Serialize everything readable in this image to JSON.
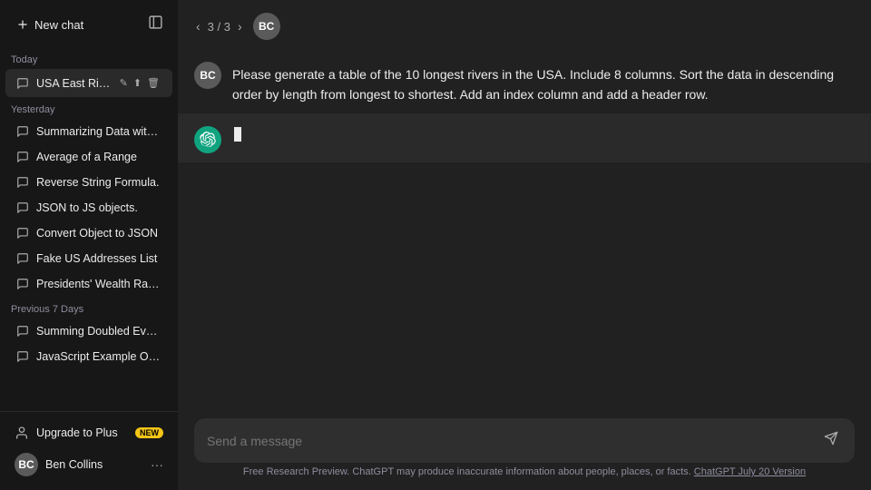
{
  "sidebar": {
    "new_chat_label": "New chat",
    "toggle_icon": "sidebar-icon",
    "today_label": "Today",
    "yesterday_label": "Yesterday",
    "previous7_label": "Previous 7 Days",
    "active_chat": "USA East Rivers Tab",
    "today_chats": [
      {
        "id": "usa-east-rivers",
        "label": "USA East Rivers Tab",
        "active": true
      }
    ],
    "yesterday_chats": [
      {
        "id": "summarizing-data",
        "label": "Summarizing Data with Formu..."
      },
      {
        "id": "average-range",
        "label": "Average of a Range"
      },
      {
        "id": "reverse-string",
        "label": "Reverse String Formula."
      },
      {
        "id": "json-js",
        "label": "JSON to JS objects."
      },
      {
        "id": "convert-object",
        "label": "Convert Object to JSON"
      },
      {
        "id": "fake-addresses",
        "label": "Fake US Addresses List"
      },
      {
        "id": "presidents-wealth",
        "label": "Presidents' Wealth Ranking"
      }
    ],
    "previous_chats": [
      {
        "id": "summing-doubled",
        "label": "Summing Doubled Even Num..."
      },
      {
        "id": "js-example",
        "label": "JavaScript Example Object."
      }
    ],
    "upgrade_label": "Upgrade to Plus",
    "new_badge": "NEW",
    "user_name": "Ben Collins",
    "user_initials": "BC"
  },
  "chat": {
    "nav_label": "3 / 3",
    "user_message": "Please generate a table of the 10 longest rivers in the USA. Include 8 columns. Sort the data in descending order by length from longest to shortest. Add an index column and add a header row.",
    "ai_responding": true
  },
  "input": {
    "placeholder": "Send a message",
    "send_icon": "send-icon"
  },
  "footer": {
    "disclaimer": "Free Research Preview. ChatGPT may produce inaccurate information about people, places, or facts.",
    "version_link": "ChatGPT July 20 Version"
  }
}
